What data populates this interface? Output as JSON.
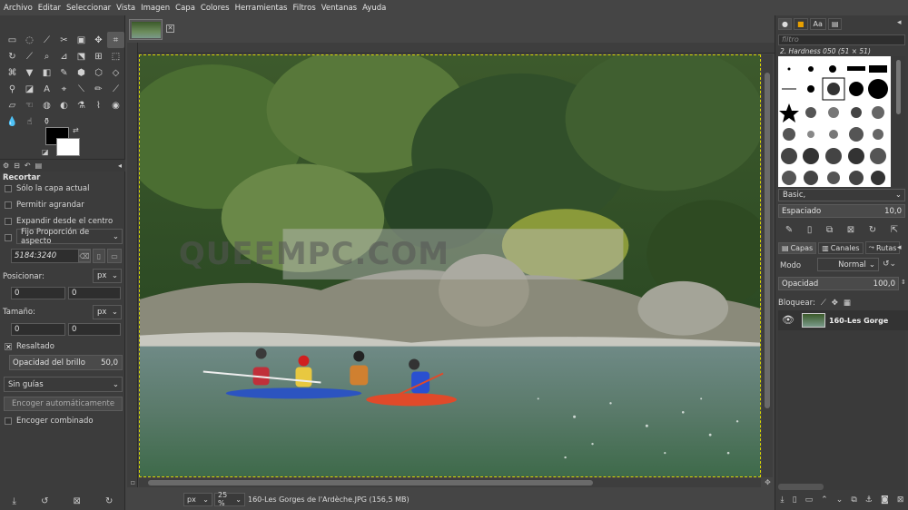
{
  "menu": [
    "Archivo",
    "Editar",
    "Seleccionar",
    "Vista",
    "Imagen",
    "Capa",
    "Colores",
    "Herramientas",
    "Filtros",
    "Ventanas",
    "Ayuda"
  ],
  "tool_options": {
    "title": "Recortar",
    "current_layer_only": "Sólo la capa actual",
    "allow_growing": "Permitir agrandar",
    "expand_from_center": "Expandir desde el centro",
    "fixed_label": "Fijo",
    "fixed_mode": "Proporción de aspecto",
    "ratio_value": "5184:3240",
    "position_label": "Posicionar:",
    "position_unit": "px",
    "position_x": "0",
    "position_y": "0",
    "size_label": "Tamaño:",
    "size_unit": "px",
    "size_w": "0",
    "size_h": "0",
    "highlight_label": "Resaltado",
    "highlight_opacity_label": "Opacidad del brillo",
    "highlight_opacity_value": "50,0",
    "guides": "Sin guías",
    "auto_shrink": "Encoger automáticamente",
    "shrink_merged": "Encoger combinado"
  },
  "status": {
    "unit": "px",
    "zoom": "25 %",
    "filename": "160-Les Gorges de l'Ardèche.JPG (156,5 MB)"
  },
  "watermark": "QUEEMPC.COM",
  "brushes": {
    "filter_placeholder": "filtro",
    "selected_name": "2. Hardness 050 (51 × 51)",
    "tag": "Basic,",
    "spacing_label": "Espaciado",
    "spacing_value": "10,0"
  },
  "layers": {
    "tabs": [
      "Capas",
      "Canales",
      "Rutas"
    ],
    "mode_label": "Modo",
    "mode_value": "Normal",
    "opacity_label": "Opacidad",
    "opacity_value": "100,0",
    "lock_label": "Bloquear:",
    "layer_name": "160-Les Gorge"
  },
  "colors": {
    "foreground": "#000000",
    "background": "#ffffff",
    "accent_highlight": "#e8e800"
  }
}
